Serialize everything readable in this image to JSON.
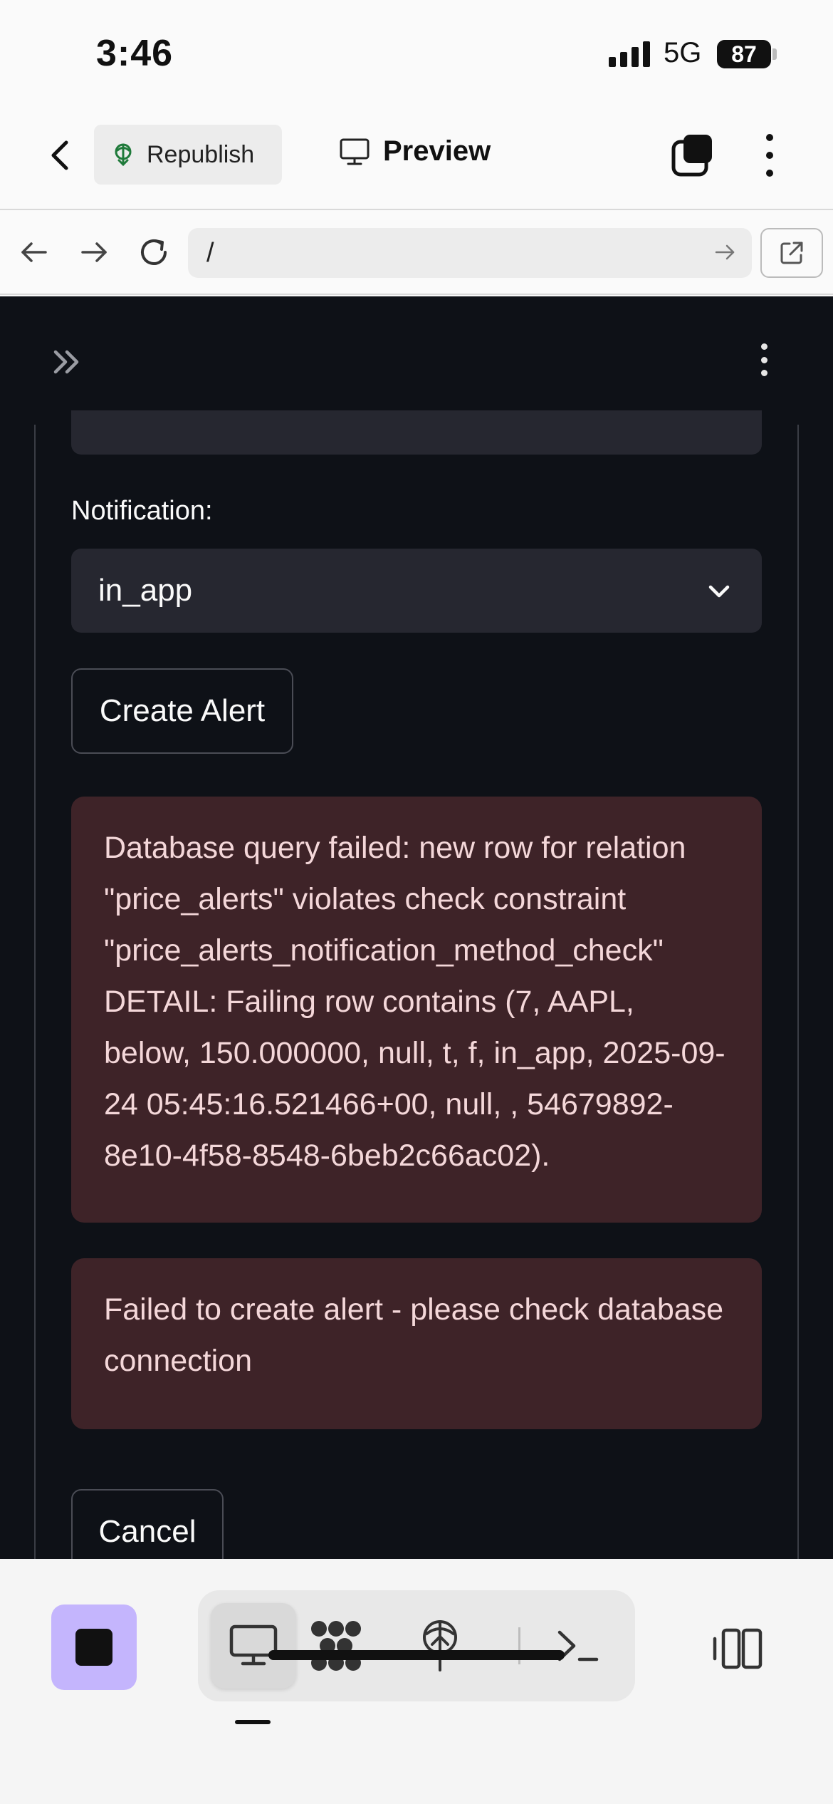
{
  "status_bar": {
    "time": "3:46",
    "network": "5G",
    "battery": "87"
  },
  "toolbar": {
    "republish_label": "Republish",
    "preview_label": "Preview"
  },
  "url_bar": {
    "url": "/"
  },
  "app": {
    "notification_label": "Notification:",
    "notification_value": "in_app",
    "create_button": "Create Alert",
    "error_1": "Database query failed: new row for relation \"price_alerts\" violates check constraint \"price_alerts_notification_method_check\" DETAIL: Failing row contains (7, AAPL, below, 150.000000, null, t, f, in_app, 2025-09-24 05:45:16.521466+00, null, , 54679892-8e10-4f58-8548-6beb2c66ac02).",
    "error_2": "Failed to create alert - please check database connection",
    "cancel_button": "Cancel"
  },
  "colors": {
    "app_background": "#0e1117",
    "field_background": "#262730",
    "error_background": "#3e2328",
    "stop_button": "#c4b5fd"
  },
  "icons": {
    "toolbar": [
      "back-icon",
      "republish-icon",
      "monitor-icon",
      "tabs-icon",
      "more-icon"
    ],
    "url_bar": [
      "back-arrow-icon",
      "forward-arrow-icon",
      "reload-icon",
      "go-icon",
      "external-link-icon"
    ],
    "bottom_bar": [
      "stop-icon",
      "monitor-icon",
      "workflow-icon",
      "deploy-icon",
      "terminal-icon",
      "panel-icon"
    ]
  }
}
